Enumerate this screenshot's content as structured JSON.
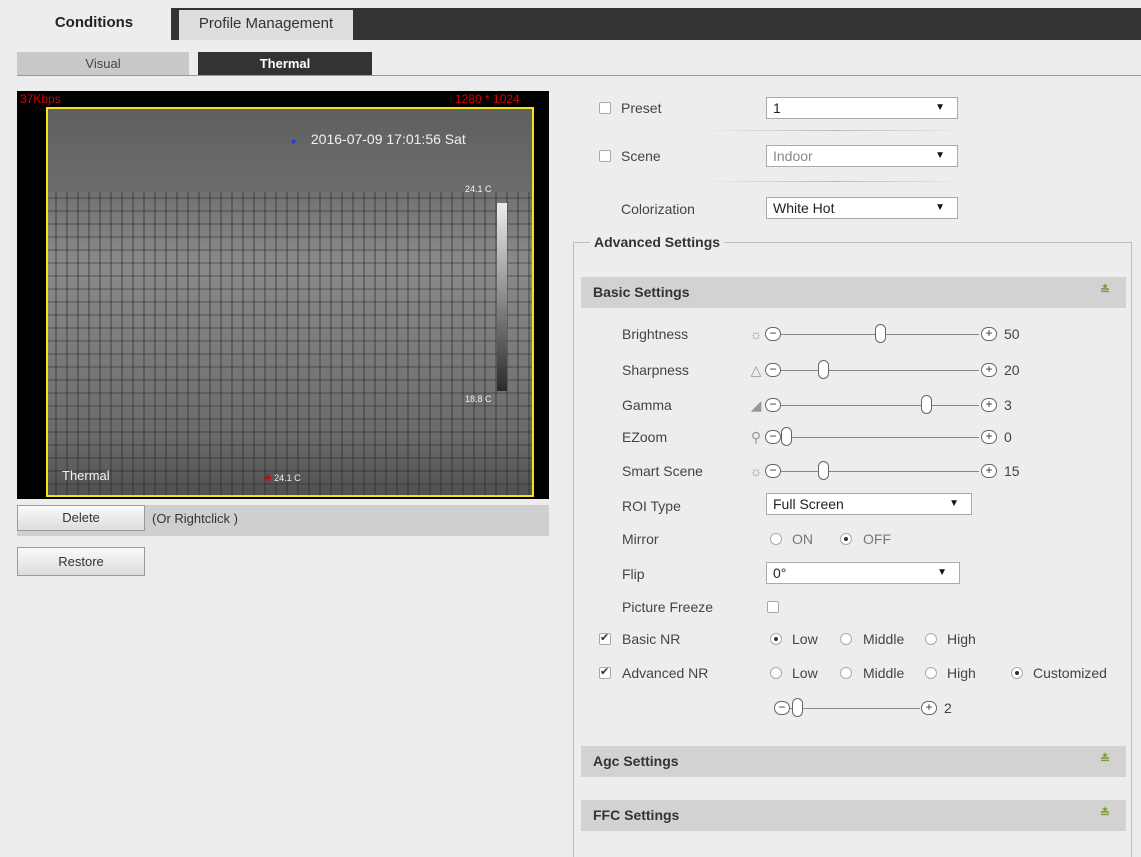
{
  "tabs": {
    "active": "Conditions",
    "inactive": "Profile Management"
  },
  "subtabs": {
    "visual": "Visual",
    "thermal": "Thermal"
  },
  "video": {
    "bitrate": "37Kbps",
    "resolution": "1280 * 1024",
    "timestamp": "2016-07-09 17:01:56 Sat",
    "channel_label": "Thermal",
    "temp_high": "24.1 C",
    "temp_low": "18.8 C",
    "temp_point": "24.1 C"
  },
  "video_tools": {
    "delete_label": "Delete",
    "hint": "(Or Rightclick )",
    "restore_label": "Restore"
  },
  "preset": {
    "label": "Preset",
    "value": "1",
    "checked": false
  },
  "scene": {
    "label": "Scene",
    "value": "Indoor",
    "checked": false
  },
  "colorization": {
    "label": "Colorization",
    "value": "White Hot"
  },
  "advanced": {
    "title": "Advanced Settings"
  },
  "basic_settings": {
    "title": "Basic Settings",
    "brightness": {
      "label": "Brightness",
      "value": "50",
      "fraction": 0.5
    },
    "sharpness": {
      "label": "Sharpness",
      "value": "20",
      "fraction": 0.2
    },
    "gamma": {
      "label": "Gamma",
      "value": "3",
      "fraction": 0.75
    },
    "ezoom": {
      "label": "EZoom",
      "value": "0",
      "fraction": 0.0
    },
    "smart_scene": {
      "label": "Smart Scene",
      "value": "15",
      "fraction": 0.2
    },
    "roi_type": {
      "label": "ROI Type",
      "value": "Full Screen"
    },
    "mirror": {
      "label": "Mirror",
      "on": "ON",
      "off": "OFF",
      "selected": "OFF"
    },
    "flip": {
      "label": "Flip",
      "value": "0°"
    },
    "picture_freeze": {
      "label": "Picture Freeze",
      "checked": false
    },
    "basic_nr": {
      "label": "Basic NR",
      "checked": true,
      "low": "Low",
      "middle": "Middle",
      "high": "High",
      "selected": "Low"
    },
    "advanced_nr": {
      "label": "Advanced NR",
      "checked": true,
      "low": "Low",
      "middle": "Middle",
      "high": "High",
      "customized": "Customized",
      "selected": "Customized",
      "value": "2",
      "fraction": 0.02
    }
  },
  "agc_settings": {
    "title": "Agc Settings"
  },
  "ffc_settings": {
    "title": "FFC Settings"
  }
}
